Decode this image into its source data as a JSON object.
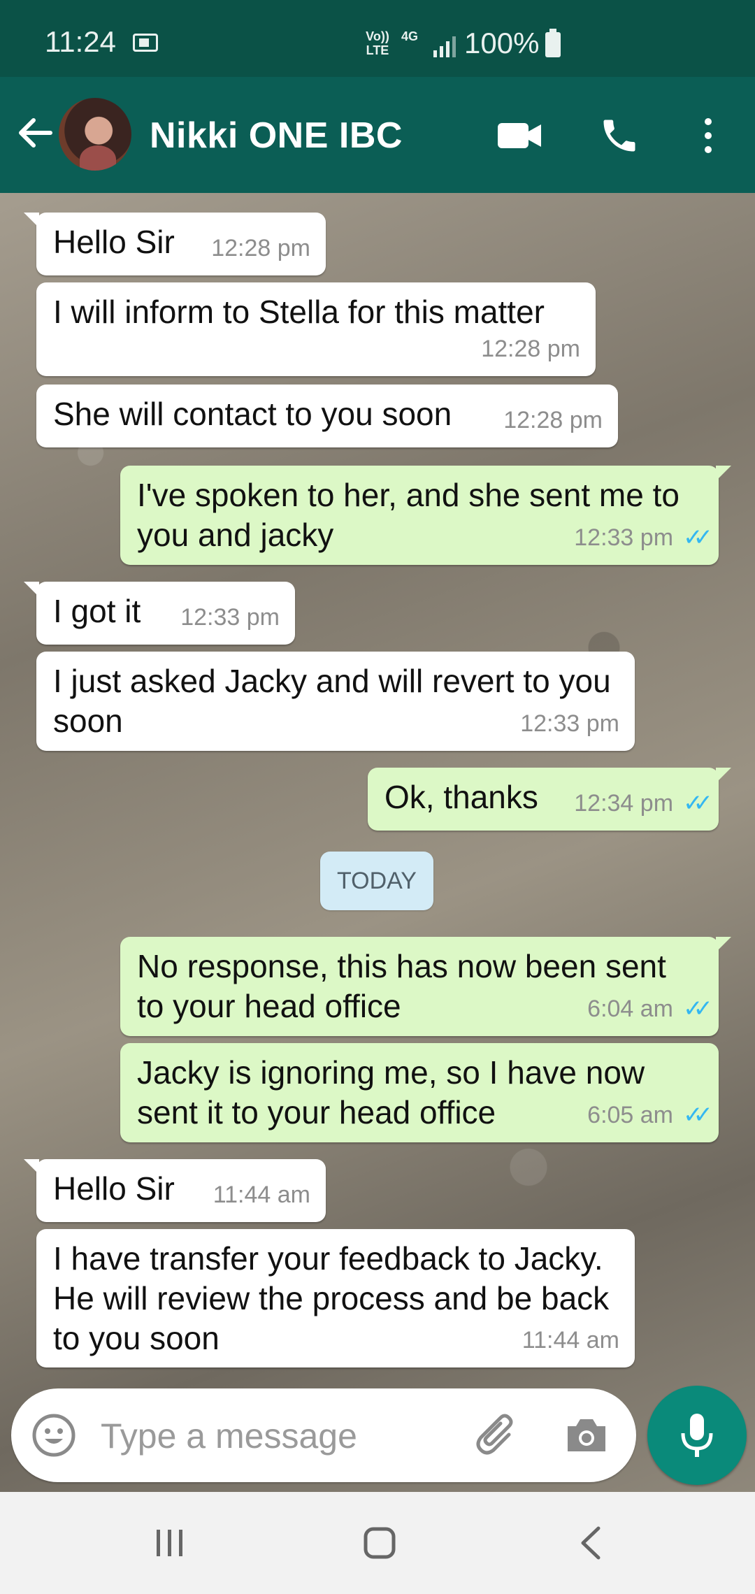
{
  "status_bar": {
    "time": "11:24",
    "volte": "Vo)) LTE",
    "network": "4G",
    "battery_text": "100%"
  },
  "header": {
    "contact_name": "Nikki ONE IBC"
  },
  "messages": [
    {
      "direction": "in",
      "text": "Hello Sir",
      "time": "12:28 pm"
    },
    {
      "direction": "in",
      "text": "I will inform to Stella for this matter",
      "time": "12:28 pm"
    },
    {
      "direction": "in",
      "text": "She will contact to you soon",
      "time": "12:28 pm"
    },
    {
      "direction": "out",
      "text": "I've spoken to her, and she sent me to you and jacky",
      "time": "12:33 pm",
      "ticks": "✓✓"
    },
    {
      "direction": "in",
      "text": "I got it",
      "time": "12:33 pm"
    },
    {
      "direction": "in",
      "text": "I just asked Jacky and will revert to you soon",
      "time": "12:33 pm"
    },
    {
      "direction": "out",
      "text": "Ok, thanks",
      "time": "12:34 pm",
      "ticks": "✓✓"
    },
    {
      "direction": "out",
      "text": "No response, this has now been sent to your head office",
      "time": "6:04 am",
      "ticks": "✓✓"
    },
    {
      "direction": "out",
      "text": "Jacky is ignoring me, so I have now sent it to your head office",
      "time": "6:05 am",
      "ticks": "✓✓"
    },
    {
      "direction": "in",
      "text": "Hello Sir",
      "time": "11:44 am"
    },
    {
      "direction": "in",
      "text": "I have transfer your feedback to Jacky. He will review the process and be back to you soon",
      "time": "11:44 am"
    }
  ],
  "date_separator": "TODAY",
  "composer": {
    "placeholder": "Type a message"
  },
  "colors": {
    "header": "#0b5e55",
    "outgoing_bubble": "#dcf8c6",
    "incoming_bubble": "#ffffff",
    "read_ticks": "#34b7f1",
    "mic_button": "#0a8a7a"
  }
}
